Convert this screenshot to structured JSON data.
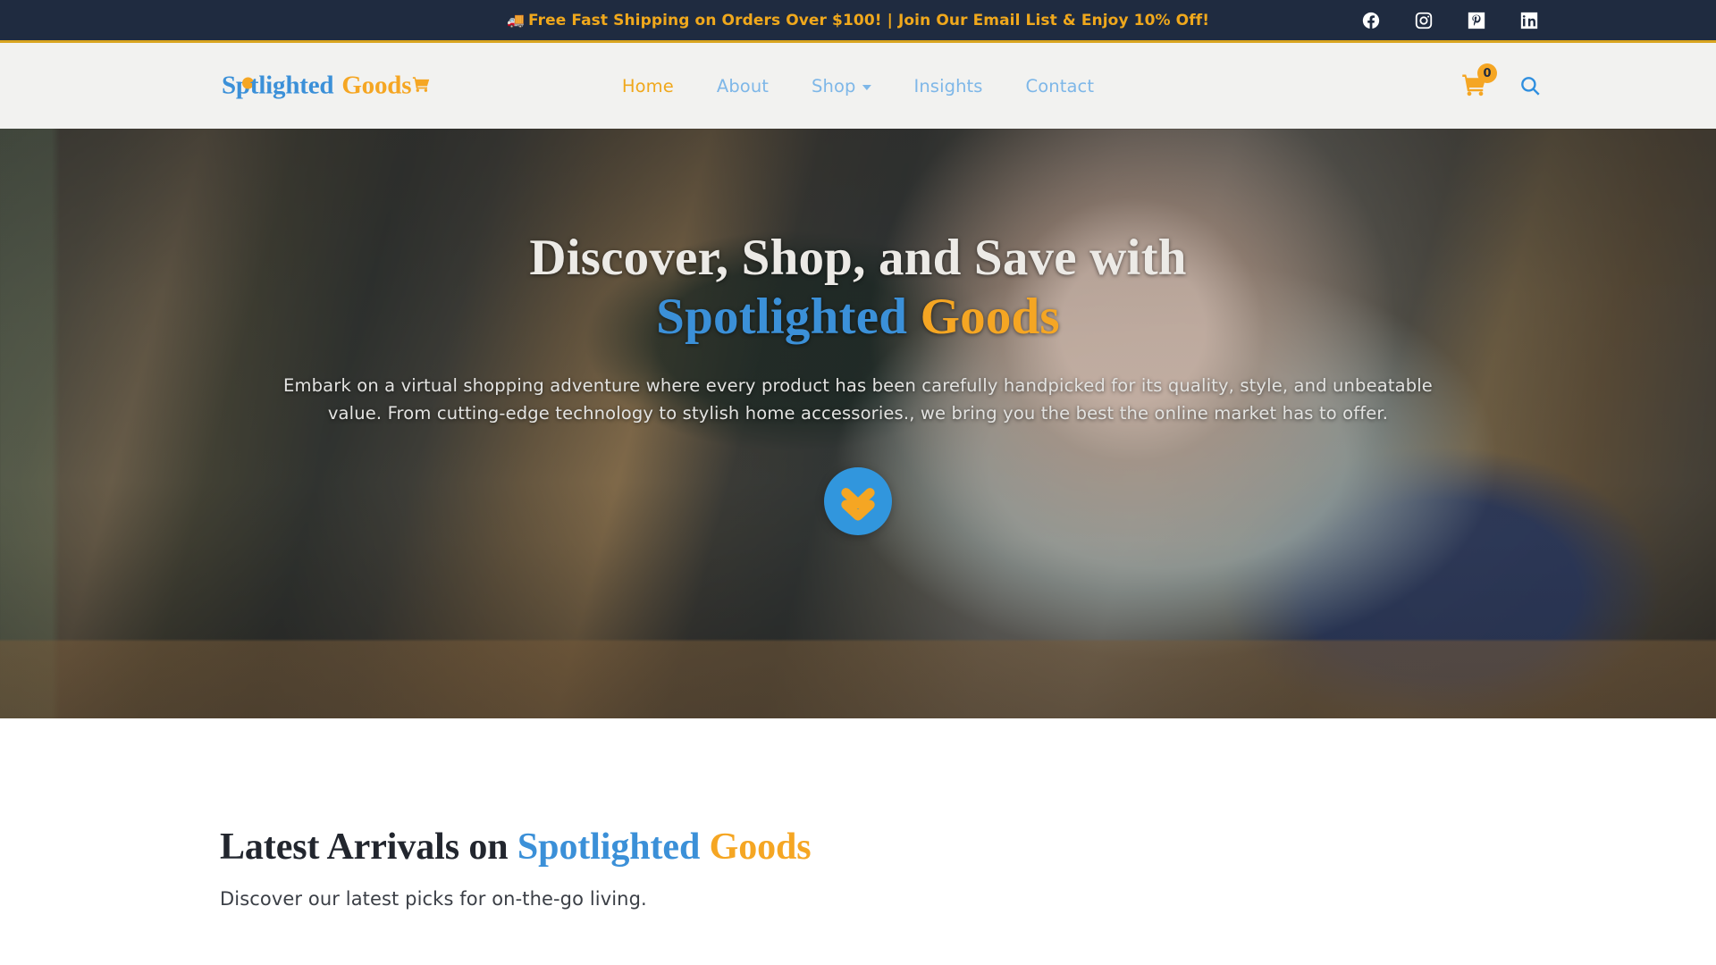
{
  "announcement": {
    "icon": "delivery-truck-icon",
    "text": "Free Fast Shipping on Orders Over $100! | Join Our Email List & Enjoy 10% Off!",
    "bg_color": "#1f2b40",
    "text_color": "#f0a81c",
    "border_color": "#d9a520",
    "social": [
      {
        "name": "facebook",
        "label": "Facebook"
      },
      {
        "name": "instagram",
        "label": "Instagram"
      },
      {
        "name": "pinterest",
        "label": "Pinterest"
      },
      {
        "name": "linkedin",
        "label": "LinkedIn"
      }
    ]
  },
  "header": {
    "bg_color": "#f2f2f0",
    "logo": {
      "part1": "Sp",
      "part2": "tlighted",
      "part3": "Goods",
      "cart_icon": "shopping-cart-icon",
      "color_primary": "#3b90d8",
      "color_accent": "#f5a623"
    },
    "nav": [
      {
        "label": "Home",
        "active": true,
        "has_dropdown": false
      },
      {
        "label": "About",
        "active": false,
        "has_dropdown": false
      },
      {
        "label": "Shop",
        "active": false,
        "has_dropdown": true
      },
      {
        "label": "Insights",
        "active": false,
        "has_dropdown": false
      },
      {
        "label": "Contact",
        "active": false,
        "has_dropdown": false
      }
    ],
    "cart": {
      "icon": "shopping-cart-icon",
      "count": "0"
    },
    "search": {
      "icon": "search-icon"
    }
  },
  "hero": {
    "heading_line1": "Discover, Shop, and Save with",
    "heading_brand1": "Spotlighted",
    "heading_brand2": "Goods",
    "paragraph_line1": "Embark on a virtual shopping adventure where every product has been carefully handpicked for its quality, style, and unbeatable value.",
    "paragraph_line2": "From cutting-edge technology to stylish home accessories., we bring you the best the online market has to offer.",
    "scroll_button": {
      "icon": "double-chevron-down-icon",
      "bg_color": "#3196dd",
      "arrow_color": "#f5a623"
    }
  },
  "latest": {
    "title_plain": "Latest Arrivals on",
    "title_brand1": "Spotlighted",
    "title_brand2": "Goods",
    "subtitle": "Discover our latest picks for on-the-go living."
  }
}
